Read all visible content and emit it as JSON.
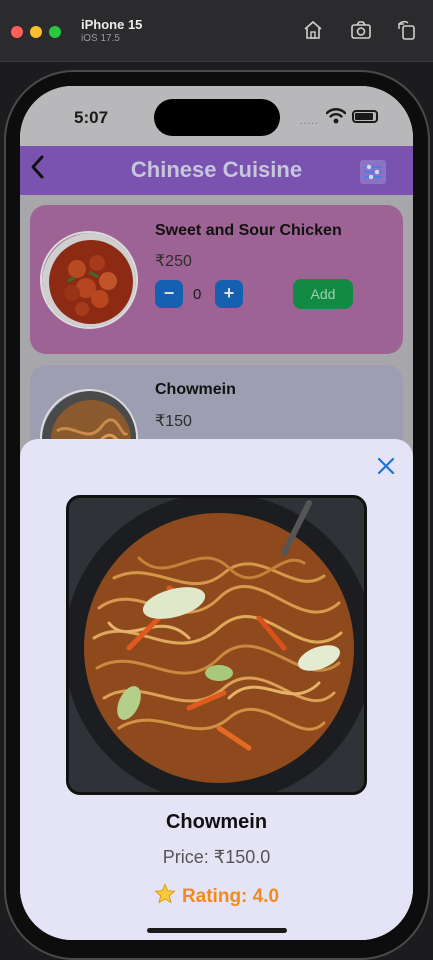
{
  "simulator": {
    "device": "iPhone 15",
    "os": "iOS 17.5"
  },
  "status_bar": {
    "time": "5:07",
    "signal": "....."
  },
  "nav": {
    "title": "Chinese Cuisine"
  },
  "menu_items": [
    {
      "name": "Sweet and Sour Chicken",
      "price": "₹250",
      "quantity": "0",
      "minus_label": "−",
      "plus_label": "+",
      "add_label": "Add"
    },
    {
      "name": "Chowmein",
      "price": "₹150"
    }
  ],
  "detail_sheet": {
    "name": "Chowmein",
    "price": "Price: ₹150.0",
    "rating": "Rating: 4.0"
  },
  "colors": {
    "nav_purple": "#7a53b0",
    "add_green": "#138a44",
    "stepper_blue": "#1660b0",
    "rating_orange": "#f28a1c",
    "sheet_bg": "#e4e4f6",
    "close_blue": "#1a73d9"
  },
  "icons": {
    "back": "chevron-left-icon",
    "filter": "filter-icon",
    "close": "close-icon",
    "star": "star-icon",
    "home": "home-icon",
    "screenshot": "camera-icon",
    "rotate": "rotate-icon"
  }
}
